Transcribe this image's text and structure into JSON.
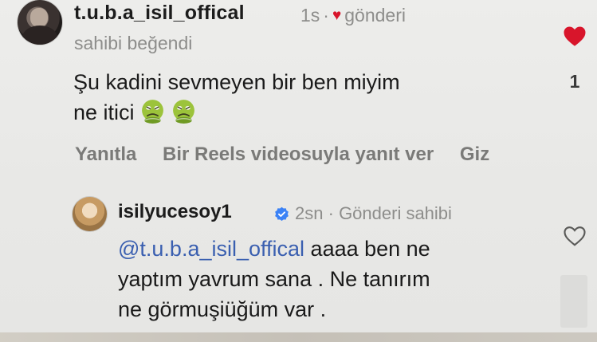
{
  "top_comment": {
    "username": "t.u.b.a_isil_offical",
    "time": "1s",
    "dot": "·",
    "liked_by_creator_line1": "gönderi",
    "liked_by_creator_line2": "sahibi beğendi",
    "text_line1": "Şu kadini sevmeyen bir ben miyim",
    "text_line2": "ne itici",
    "emojis": [
      "nauseated-face-emoji",
      "nauseated-face-emoji"
    ],
    "actions": {
      "reply": "Yanıtla",
      "reels_reply": "Bir Reels videosuyla yanıt ver",
      "hide": "Giz"
    },
    "like_count": "1",
    "heart_color": "#d8152b"
  },
  "reply": {
    "username": "isilyucesoy1",
    "time": "2sn",
    "dot": "·",
    "badge": "Gönderi sahibi",
    "mention": "@t.u.b.a_isil_offical",
    "text_line1_rest": " aaaa ben ne",
    "text_line2": "yaptım yavrum sana . Ne tanırım",
    "text_line3": "ne görmuşiüğüm var .",
    "mention_color": "#3a5fb0",
    "verified_color": "#3b82f6"
  }
}
